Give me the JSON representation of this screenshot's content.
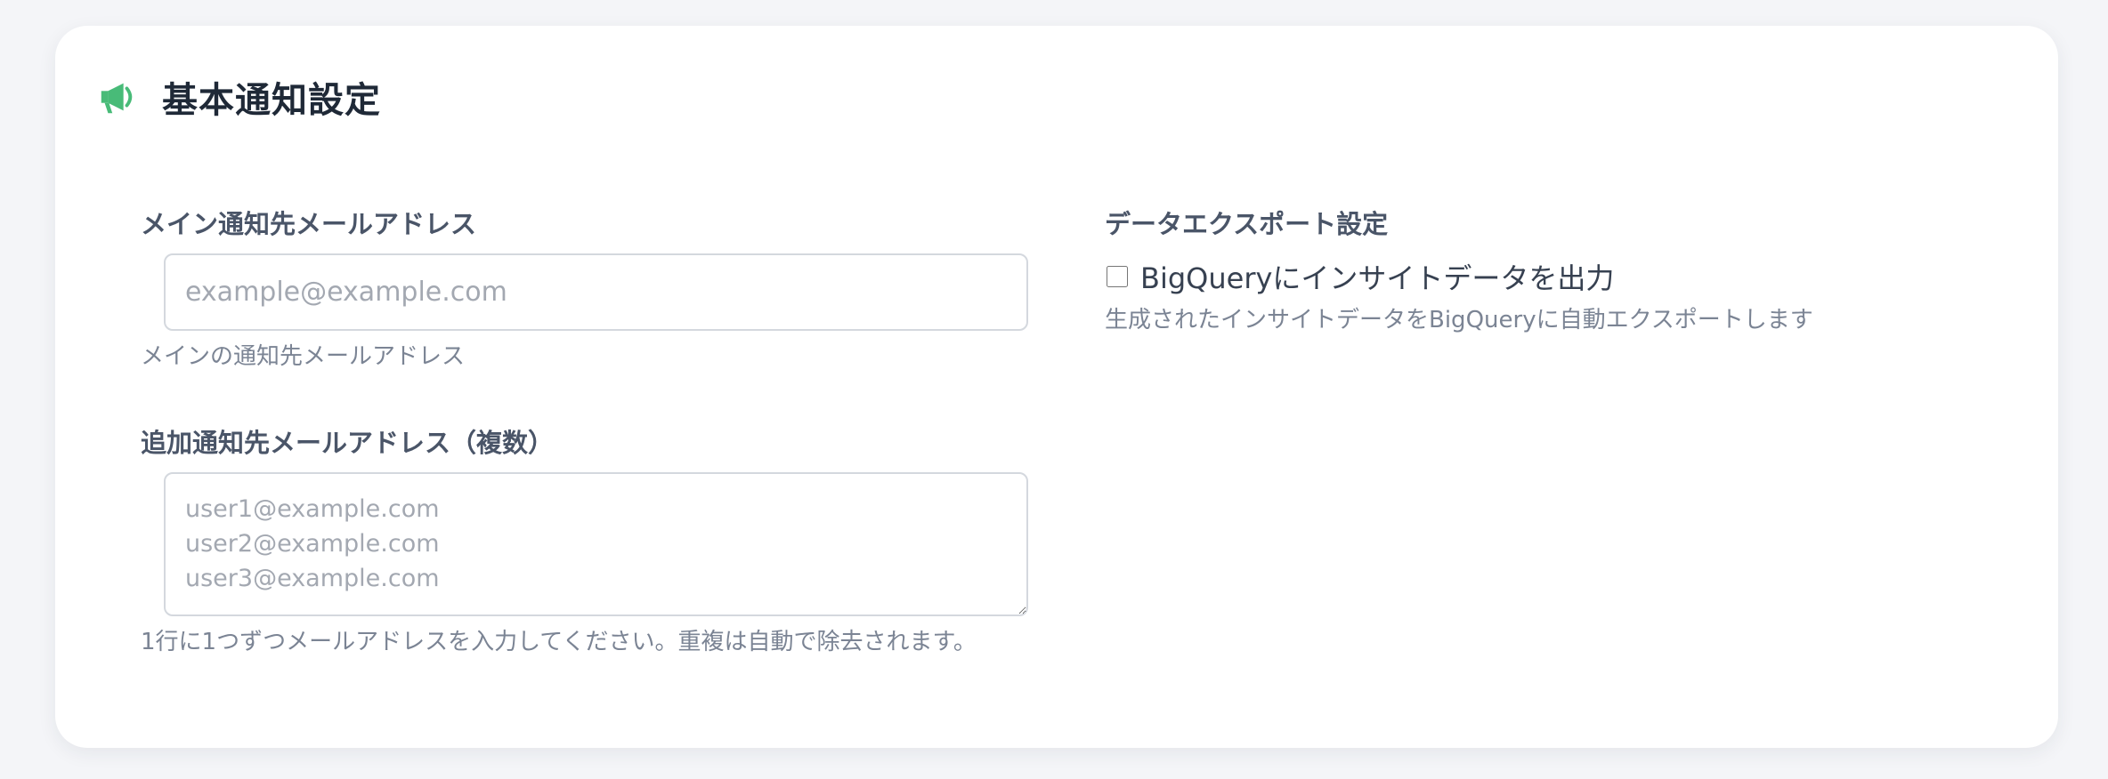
{
  "section": {
    "title": "基本通知設定",
    "icon": "megaphone-icon",
    "icon_color": "#48bb78"
  },
  "main_email": {
    "label": "メイン通知先メールアドレス",
    "placeholder": "example@example.com",
    "value": "",
    "help": "メインの通知先メールアドレス"
  },
  "additional_emails": {
    "label": "追加通知先メールアドレス（複数）",
    "placeholder": "user1@example.com\nuser2@example.com\nuser3@example.com",
    "value": "",
    "help": "1行に1つずつメールアドレスを入力してください。重複は自動で除去されます。"
  },
  "data_export": {
    "label": "データエクスポート設定",
    "checkbox_label": "BigQueryにインサイトデータを出力",
    "checked": false,
    "help": "生成されたインサイトデータをBigQueryに自動エクスポートします"
  }
}
